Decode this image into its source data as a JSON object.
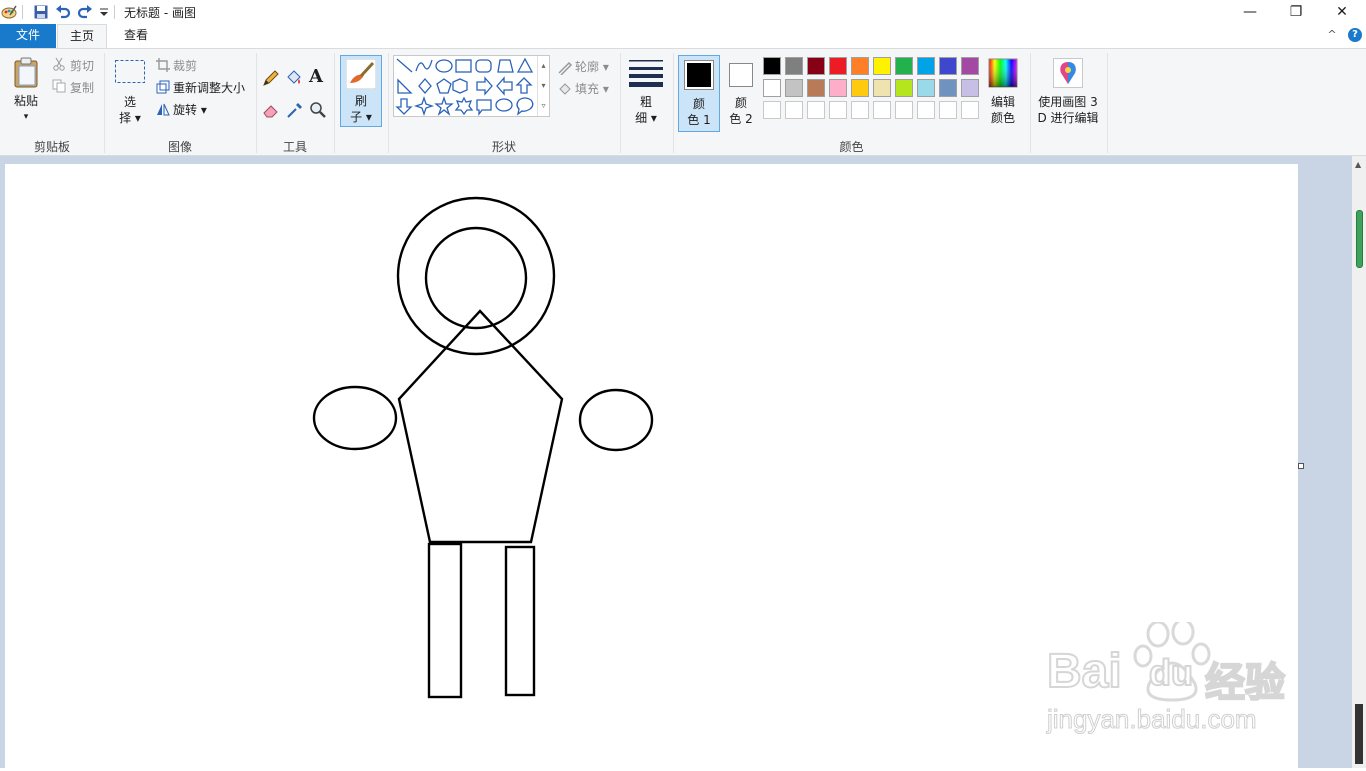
{
  "app": {
    "title": "无标题 - 画图"
  },
  "window_controls": {
    "minimize": "—",
    "maximize": "❐",
    "close": "✕"
  },
  "tabs": {
    "file": "文件",
    "home": "主页",
    "view": "查看"
  },
  "help": {
    "collapse": "^",
    "help": "?"
  },
  "clipboard": {
    "paste": "粘贴",
    "paste_arrow": "▾",
    "cut": "剪切",
    "copy": "复制",
    "group": "剪贴板"
  },
  "image": {
    "select_1": "选",
    "select_2": "择 ▾",
    "crop": "裁剪",
    "resize": "重新调整大小",
    "rotate": "旋转 ▾",
    "group": "图像"
  },
  "tools": {
    "text": "A",
    "group": "工具"
  },
  "brush": {
    "label_1": "刷",
    "label_2": "子 ▾"
  },
  "shapes": {
    "outline": "轮廓 ▾",
    "fill": "填充 ▾",
    "group": "形状"
  },
  "size": {
    "label_1": "粗",
    "label_2": "细 ▾"
  },
  "colors": {
    "color1_1": "颜",
    "color1_2": "色 1",
    "color2_1": "颜",
    "color2_2": "色 2",
    "edit_1": "编辑",
    "edit_2": "颜色",
    "paint3d_1": "使用画图 3",
    "paint3d_2": "D 进行编辑",
    "group": "颜色",
    "color1_value": "#000000",
    "color2_value": "#ffffff",
    "row1": [
      "#000000",
      "#7f7f7f",
      "#880015",
      "#ed1c24",
      "#ff7f27",
      "#fff200",
      "#22b14c",
      "#00a2e8",
      "#3f48cc",
      "#a349a4"
    ],
    "row2": [
      "#ffffff",
      "#c3c3c3",
      "#b97a57",
      "#ffaec9",
      "#ffc90e",
      "#efe4b0",
      "#b5e61d",
      "#99d9ea",
      "#7092be",
      "#c8bfe7"
    ]
  },
  "watermark": {
    "brand": "Bai",
    "brand2": "du",
    "product": "经验",
    "url": "jingyan.baidu.com"
  }
}
